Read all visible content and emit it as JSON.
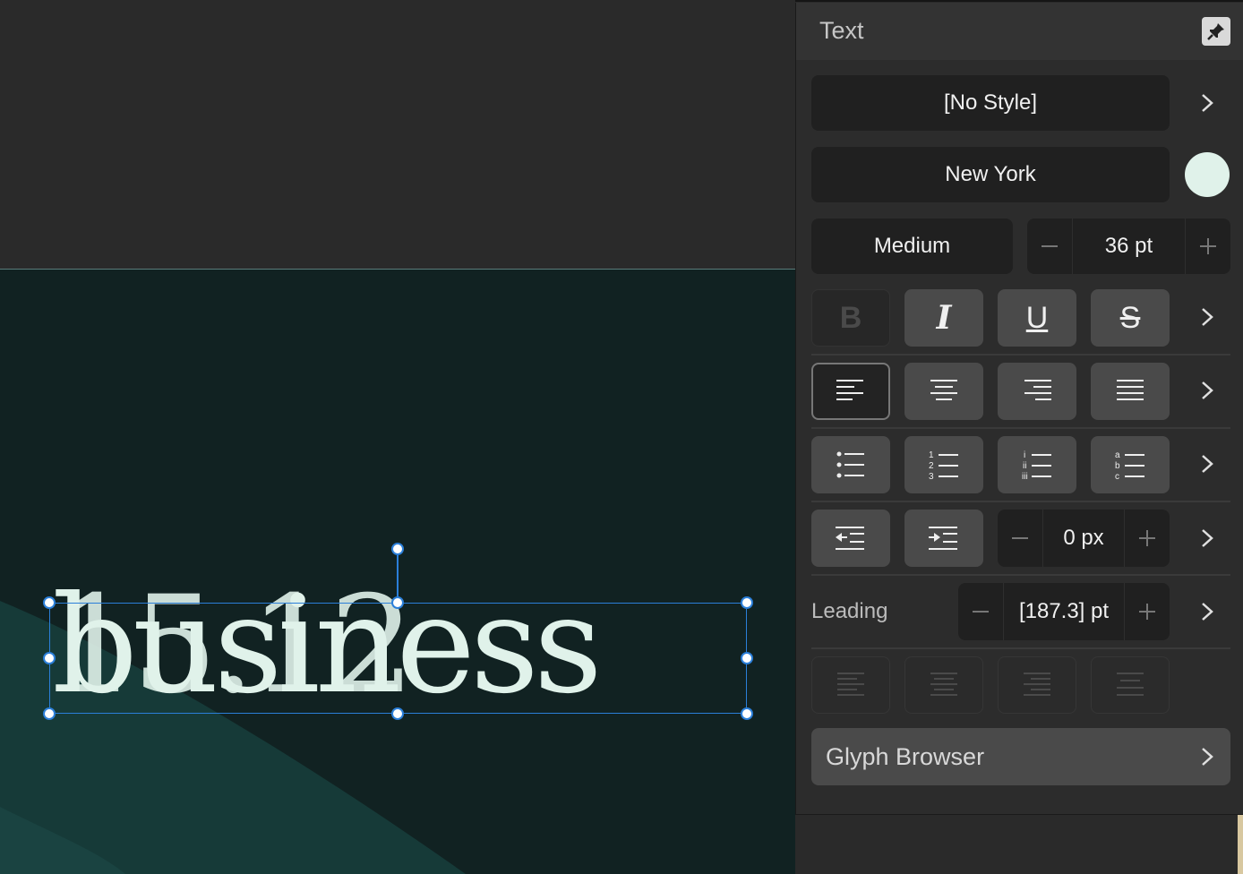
{
  "canvas": {
    "text_frame_content": "business",
    "overlap_text": "15.12"
  },
  "panel": {
    "title": "Text",
    "paragraph_style": "[No Style]",
    "font_family": "New York",
    "font_color": "#e0f2ea",
    "font_weight": "Medium",
    "font_size": "36 pt",
    "indent": "0 px",
    "leading_label": "Leading",
    "leading_value": "[187.3] pt",
    "glyph_browser": "Glyph Browser",
    "style_buttons": [
      "B",
      "I",
      "U",
      "S"
    ]
  },
  "colors": {
    "canvas_bg": "#112222",
    "selection": "#2b7fd9",
    "panel_bg": "#2c2c2c"
  }
}
